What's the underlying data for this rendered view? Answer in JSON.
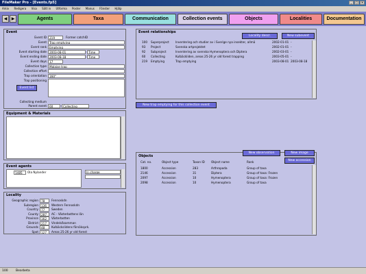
{
  "window": {
    "title": "FileMaker Pro - [Events.fp5]"
  },
  "menu": [
    "Arkiv",
    "Redigera",
    "Visa",
    "Sätt in",
    "Utforma",
    "Poster",
    "Manus",
    "Fönster",
    "Hjälp"
  ],
  "tabs": [
    {
      "label": "Agents",
      "color": "#7fd07f"
    },
    {
      "label": "Taxa",
      "color": "#f2a07a"
    },
    {
      "label": "Communication",
      "color": "#99e0e0"
    },
    {
      "label": "Collection events",
      "color": "#d8d0e8"
    },
    {
      "label": "Objects",
      "color": "#f0a0f0"
    },
    {
      "label": "Localities",
      "color": "#f08a8a"
    },
    {
      "label": "Documentation",
      "color": "#f4c890"
    }
  ],
  "event": {
    "title": "Event",
    "fields": [
      {
        "label": "Event ID",
        "value": "219"
      },
      {
        "label": "Event",
        "value": "Trap emptying"
      },
      {
        "label": "Event rank",
        "value": "Emptying"
      },
      {
        "label": "Event starting date",
        "value": "2003-08-01"
      },
      {
        "label": "Event ending date",
        "value": "2003-08-18"
      },
      {
        "label": "Event days",
        "value": "17"
      },
      {
        "label": "Collection type",
        "value": "Malaise trap"
      },
      {
        "label": "Collection effort",
        "value": ""
      },
      {
        "label": "Trap orientation",
        "value": "160°"
      },
      {
        "label": "Trap positioning",
        "value": ""
      }
    ],
    "former_label": "Former catchID",
    "time_label_1": "Time",
    "time_label_2": "Time",
    "event_list_btn": "Event list",
    "collecting_medium_label": "Collecting medium",
    "parent_event_label": "Parent event",
    "parent_event_value": "60",
    "parent_event_type": "Collecting"
  },
  "equipment": {
    "title": "Equipment & Materials"
  },
  "agents": {
    "title": "Event agents",
    "id": "1485",
    "name": "Ola Nylander",
    "role": "In charge"
  },
  "locality": {
    "title": "Locality",
    "rows": [
      {
        "label": "Geographic region",
        "id": "78",
        "name": "Fennoskdn"
      },
      {
        "label": "Subregion",
        "id": "136",
        "name": "Western Fennoskdn"
      },
      {
        "label": "Country",
        "id": "77",
        "name": "Sweden"
      },
      {
        "label": "County",
        "id": "287",
        "name": "AC - Västerbottens län"
      },
      {
        "label": "Province",
        "id": "162",
        "name": "Västerbotten"
      },
      {
        "label": "District",
        "id": "217",
        "name": "Vindelsåsamman"
      },
      {
        "label": "Grounds",
        "id": "48",
        "name": "Kulbäckslidens försöksprk."
      },
      {
        "label": "Spot",
        "id": "127",
        "name": "Areas 25-26 yr old forest"
      }
    ]
  },
  "relationships": {
    "title": "Event relationships",
    "btn_locality": "Locality descr.",
    "btn_subevent": "New subevent",
    "rows": [
      {
        "id": "100",
        "rank": "Superproject",
        "desc": "Inventering och studier av i Sverige nya insekter, allmä",
        "start": "2002-01-01",
        "end": "-"
      },
      {
        "id": "93",
        "rank": "Project",
        "desc": "Svenska artprojektet",
        "start": "2002-01-01",
        "end": "-"
      },
      {
        "id": "92",
        "rank": "Subproject",
        "desc": "Inventering av svenska Hymenoptera och Diptera",
        "start": "2002-03-01",
        "end": "-"
      },
      {
        "id": "60",
        "rank": "Collecting",
        "desc": "Kulbäckliden, areas 25-26 yr old forest trapping",
        "start": "2003-05-01",
        "end": "-"
      },
      {
        "id": "219",
        "rank": "Emptying",
        "desc": "Trap emptying",
        "start": "2003-08-01",
        "end": "2003-08-18"
      }
    ]
  },
  "new_trap_btn": "New trap emptying for this collection event",
  "objects": {
    "title": "Objects",
    "btn_observation": "New observation",
    "btn_image": "New image",
    "btn_accession": "New accession",
    "headers": [
      "Cat. no.",
      "Object type",
      "Taxon ID",
      "Object name",
      "Rank"
    ],
    "rows": [
      {
        "cat": "1800",
        "type": "Accession",
        "taxon": "283",
        "name": "Arthropoda",
        "rank": "Group of taxa"
      },
      {
        "cat": "2146",
        "type": "Accession",
        "taxon": "31",
        "name": "Diptera",
        "rank": "Group of taxa: Frozen"
      },
      {
        "cat": "2097",
        "type": "Accession",
        "taxon": "10",
        "name": "Hymenoptera",
        "rank": "Group of taxa: Frozen"
      },
      {
        "cat": "2098",
        "type": "Accession",
        "taxon": "10",
        "name": "Hymenoptera",
        "rank": "Group of taxa"
      }
    ]
  },
  "status": {
    "zoom": "100",
    "mode": "Bearbeta"
  }
}
